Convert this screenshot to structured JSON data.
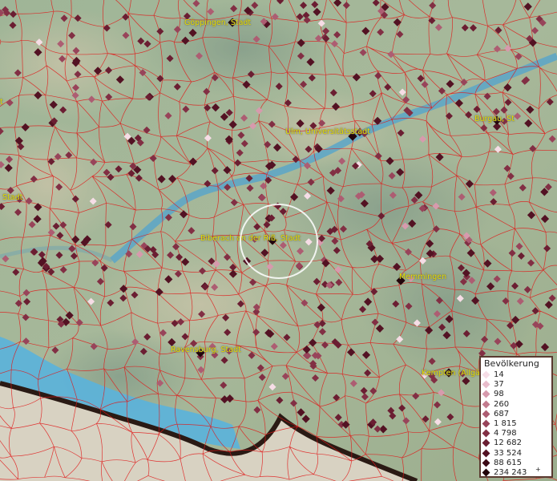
{
  "map": {
    "cities": [
      {
        "id": "goeppingen",
        "label": "Göppingen, Stadt"
      },
      {
        "id": "ulm",
        "label": "Ulm, Universitätsstadt"
      },
      {
        "id": "burgau",
        "label": "Burgau, St"
      },
      {
        "id": "biberach",
        "label": "Biberach an der Riß, Stadt"
      },
      {
        "id": "memmingen",
        "label": "Memmingen"
      },
      {
        "id": "ravensburg",
        "label": "Ravensburg, Stadt"
      },
      {
        "id": "kempten",
        "label": "Kempten (Allgä"
      },
      {
        "id": "left1",
        "label": "t"
      },
      {
        "id": "left2",
        "label": "Stadt"
      }
    ]
  },
  "legend": {
    "title": "Bevölkerung",
    "overflow_mark": "+",
    "classes": [
      {
        "label": "14",
        "color": "#f6dde6"
      },
      {
        "label": "37",
        "color": "#e9bccb"
      },
      {
        "label": "98",
        "color": "#d79aad"
      },
      {
        "label": "260",
        "color": "#c37b8e"
      },
      {
        "label": "687",
        "color": "#ad5d72"
      },
      {
        "label": "1 815",
        "color": "#98445a"
      },
      {
        "label": "4 798",
        "color": "#822f44"
      },
      {
        "label": "12 682",
        "color": "#6b1e32"
      },
      {
        "label": "33 524",
        "color": "#531223"
      },
      {
        "label": "88 615",
        "color": "#3c0a16"
      },
      {
        "label": "234 243",
        "color": "#22040b"
      }
    ]
  },
  "colors": {
    "land": "#a8b79c",
    "river": "#5aa6c8",
    "lake": "#5ab2dc",
    "boundary": "#e01818",
    "alps": "#d8d0c0",
    "city_label": "#e8e000"
  }
}
